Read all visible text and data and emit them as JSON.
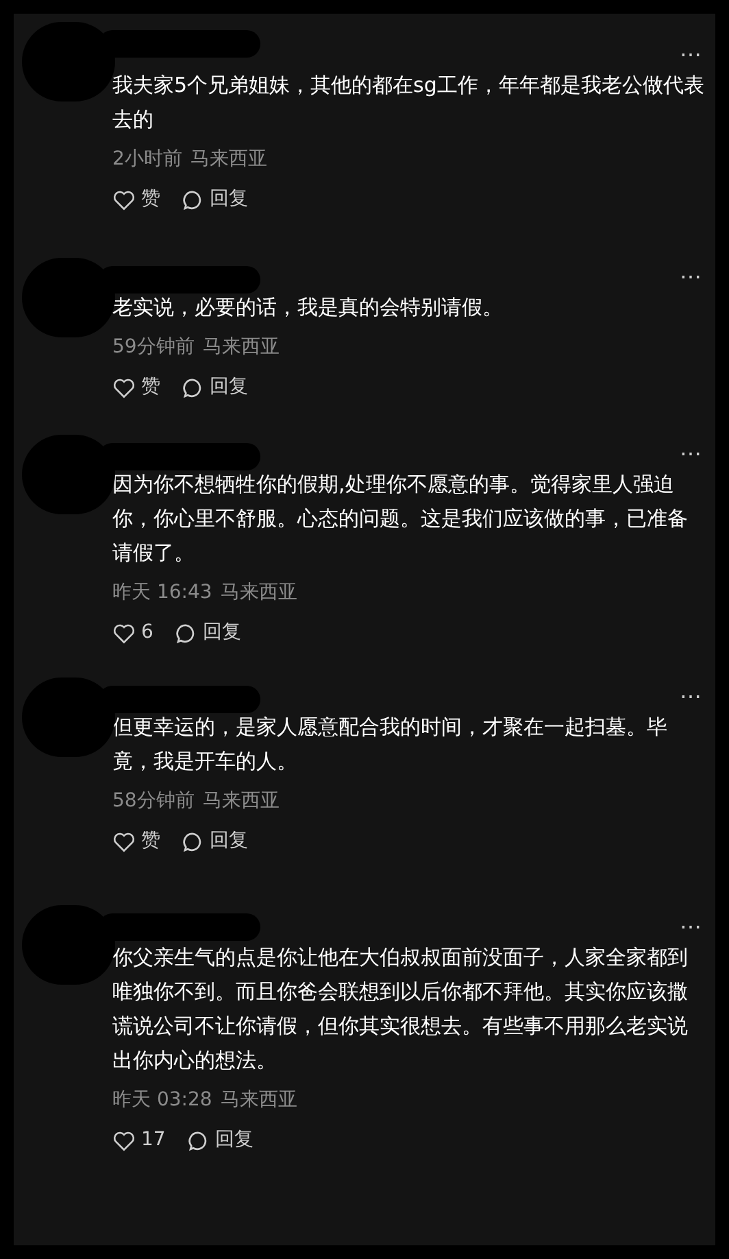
{
  "comments": [
    {
      "text": "我夫家5个兄弟姐妹，其他的都在sg工作，年年都是我老公做代表去的",
      "time": "2小时前",
      "location": "马来西亚",
      "likes": "赞",
      "reply": "回复",
      "more": "…"
    },
    {
      "text": "老实说，必要的话，我是真的会特别请假。",
      "time": "59分钟前",
      "location": "马来西亚",
      "likes": "赞",
      "reply": "回复",
      "more": "…"
    },
    {
      "text": "因为你不想牺牲你的假期,处理你不愿意的事。觉得家里人强迫你，你心里不舒服。心态的问题。这是我们应该做的事，已准备请假了。",
      "time": "昨天 16:43",
      "location": "马来西亚",
      "likes": "6",
      "reply": "回复",
      "more": "…"
    },
    {
      "text": "但更幸运的，是家人愿意配合我的时间，才聚在一起扫墓。毕竟，我是开车的人。",
      "time": "58分钟前",
      "location": "马来西亚",
      "likes": "赞",
      "reply": "回复",
      "more": "…"
    },
    {
      "text": "你父亲生气的点是你让他在大伯叔叔面前没面子，人家全家都到唯独你不到。而且你爸会联想到以后你都不拜他。其实你应该撒谎说公司不让你请假，但你其实很想去。有些事不用那么老实说出你内心的想法。",
      "time": "昨天 03:28",
      "location": "马来西亚",
      "likes": "17",
      "reply": "回复",
      "more": "…"
    }
  ]
}
